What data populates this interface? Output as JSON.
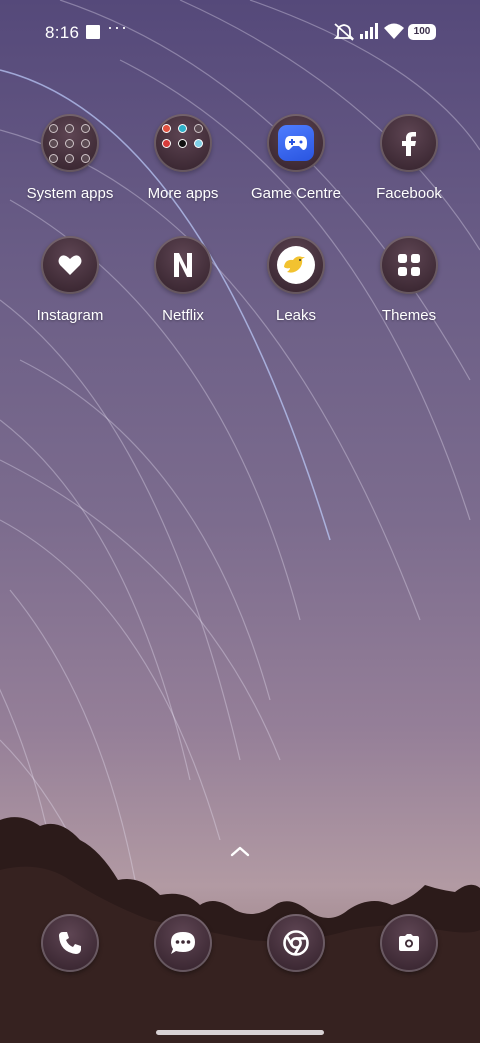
{
  "status_bar": {
    "time": "8:16",
    "battery": "100",
    "icons": [
      "stop-square-icon",
      "more-dots-icon",
      "mute-icon",
      "signal-icon",
      "wifi-icon",
      "battery-icon"
    ]
  },
  "apps": [
    {
      "label": "System apps",
      "icon": "folder-icon"
    },
    {
      "label": "More apps",
      "icon": "folder-icon"
    },
    {
      "label": "Game Centre",
      "icon": "game-controller-icon"
    },
    {
      "label": "Facebook",
      "icon": "facebook-icon"
    },
    {
      "label": "Instagram",
      "icon": "heart-icon"
    },
    {
      "label": "Netflix",
      "icon": "netflix-icon"
    },
    {
      "label": "Leaks",
      "icon": "bird-icon"
    },
    {
      "label": "Themes",
      "icon": "grid-icon"
    }
  ],
  "dock": {
    "apps": [
      {
        "name": "Phone",
        "icon": "phone-icon"
      },
      {
        "name": "Messages",
        "icon": "chat-icon"
      },
      {
        "name": "Chrome",
        "icon": "chrome-icon"
      },
      {
        "name": "Camera",
        "icon": "camera-icon"
      }
    ]
  },
  "gesture": {
    "swipe_up": "chevron-up-icon"
  },
  "colors": {
    "game_centre": "#3a67f5",
    "leaks_bird": "#f2c230"
  }
}
